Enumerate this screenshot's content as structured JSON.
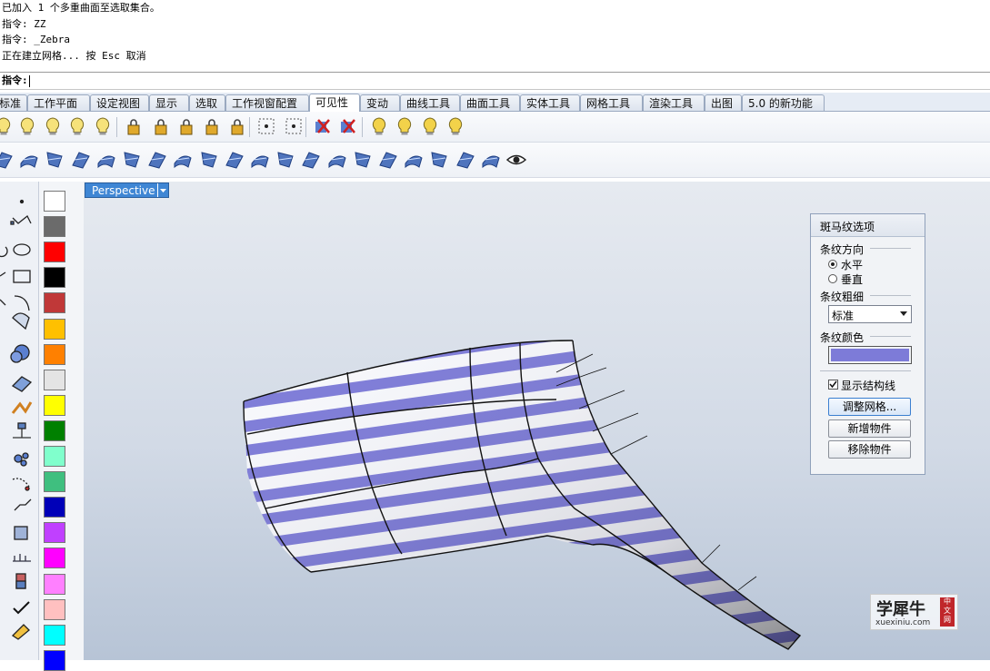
{
  "history": {
    "lines": [
      "已加入 1 个多重曲面至选取集合。",
      "指令: ZZ",
      "指令: _Zebra",
      "正在建立网格... 按 Esc 取消"
    ]
  },
  "command": {
    "prompt": "指令:"
  },
  "tabs": [
    "标准",
    "工作平面",
    "设定视图",
    "显示",
    "选取",
    "工作视窗配置",
    "可见性",
    "变动",
    "曲线工具",
    "曲面工具",
    "实体工具",
    "网格工具",
    "渲染工具",
    "出图",
    "5.0 的新功能"
  ],
  "active_tab": "可见性",
  "toolbar_visibility": {
    "icons": [
      "show-objects-icon",
      "hide-objects-icon",
      "show-selected-icon",
      "hide-selected-icon",
      "swap-hidden-icon",
      "lock-icon",
      "unlock-icon",
      "lock-selected-icon",
      "unlock-selected-icon",
      "swap-locked-icon",
      "show-points-icon",
      "points-off-icon",
      "isolate-icon",
      "delete-isolate-icon",
      "layer-on-icon",
      "layer-off-icon",
      "layer-toggle-icon",
      "layer-current-icon"
    ]
  },
  "toolbar_surface": {
    "icons": [
      "blend-surface-icon",
      "extend-surface-icon",
      "fillet-surface-icon",
      "loft-icon",
      "network-srf-icon",
      "patch-icon",
      "offset-srf-icon",
      "match-srf-icon",
      "rebuild-srf-icon",
      "sweep1-icon",
      "sweep2-icon",
      "rail-revolve-icon",
      "split-edge-icon",
      "merge-srf-icon",
      "unroll-srf-icon",
      "edit-points-icon",
      "curvature-icon",
      "draft-angle-icon",
      "zebra-icon",
      "environment-map-icon",
      "eye-icon"
    ]
  },
  "colors": {
    "swatches": [
      "#ffffff",
      "#6b6b6b",
      "#ff0000",
      "#000000",
      "#c03838",
      "#ffc000",
      "#ff8000",
      "#e4e4e4",
      "#ffff00",
      "#008000",
      "#80ffcc",
      "#3fbf7f",
      "#0000b8",
      "#c040ff",
      "#ff00ff",
      "#ff80ff",
      "#ffc0c0",
      "#00ffff",
      "#0000ff"
    ],
    "zebra_stripe": "#7d7bd8",
    "viewport_tab": "#3f86d4"
  },
  "viewport": {
    "name": "Perspective"
  },
  "zebra_dialog": {
    "title": "斑马纹选项",
    "close": "×",
    "direction_label": "条纹方向",
    "option_horizontal": "水平",
    "option_vertical": "垂直",
    "horizontal_selected": true,
    "thickness_label": "条纹粗细",
    "thickness_value": "标准",
    "color_label": "条纹颜色",
    "stripe_color": "#7d7bd8",
    "show_isocurves_label": "显示结构线",
    "show_isocurves": true,
    "btn_adjust_mesh": "调整网格...",
    "btn_add_objects": "新增物件",
    "btn_remove_objects": "移除物件"
  },
  "watermark": {
    "brand": "学犀牛",
    "url": "xuexiniu.com",
    "seal": [
      "中",
      "文",
      "网"
    ]
  }
}
